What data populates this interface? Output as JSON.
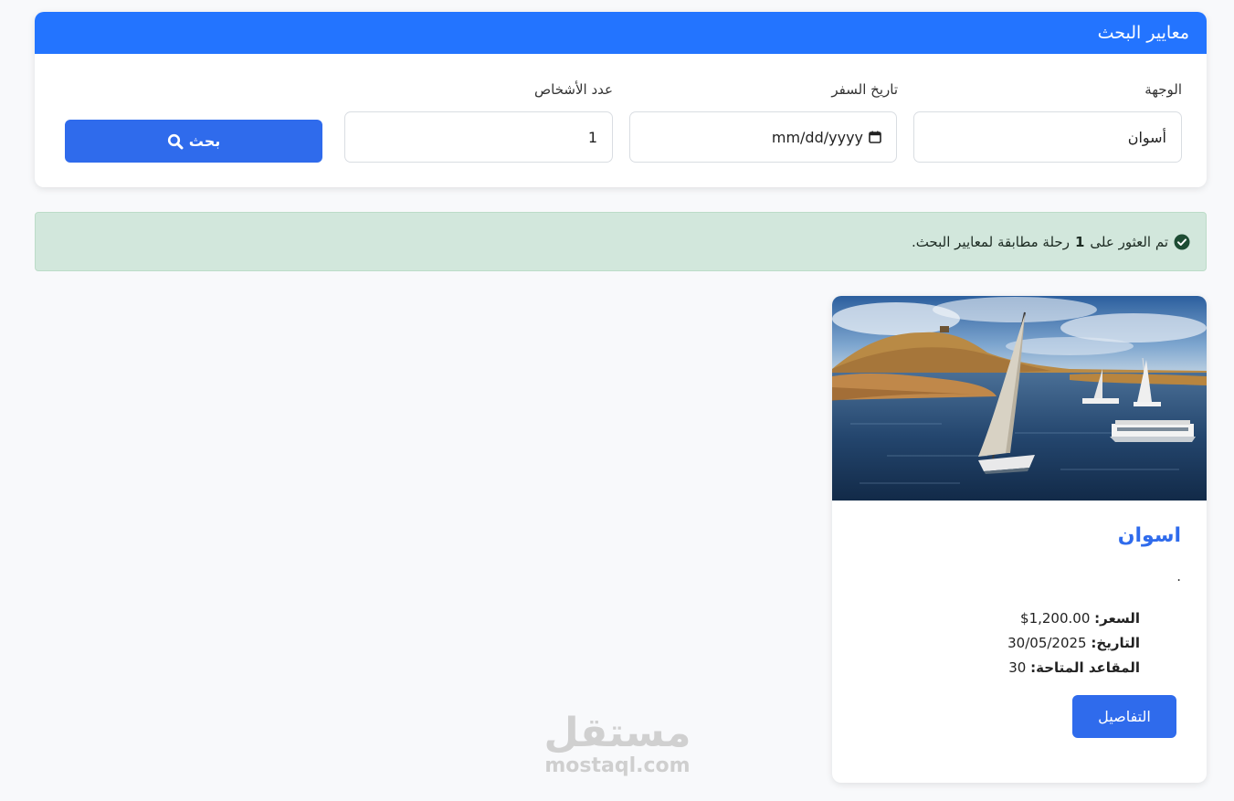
{
  "search": {
    "header_title": "معايير البحث",
    "destination_label": "الوجهة",
    "destination_value": "أسوان",
    "date_label": "تاريخ السفر",
    "date_placeholder": "mm/dd/yyyy",
    "people_label": "عدد الأشخاص",
    "people_value": "1",
    "button_label": "بحث"
  },
  "alert": {
    "text_before": "تم العثور على",
    "count": "1",
    "text_after": "رحلة مطابقة لمعايير البحث."
  },
  "trip": {
    "title": "اسوان",
    "description": ".",
    "price_label": "السعر:",
    "price_value": "1,200.00$",
    "date_label": "التاريخ:",
    "date_value": "30/05/2025",
    "seats_label": "المقاعد المتاحة:",
    "seats_value": "30",
    "details_button": "التفاصيل"
  },
  "watermark": {
    "arabic": "مستقل",
    "latin": "mostaql.com"
  },
  "colors": {
    "primary": "#2374ff",
    "button": "#2f6bec",
    "success_bg": "#d2e7dc",
    "success_icon": "#1e4d34"
  },
  "icons": {
    "search_button_icon": "search-icon",
    "date_icon": "calendar-icon",
    "alert_icon": "check-circle-icon"
  }
}
